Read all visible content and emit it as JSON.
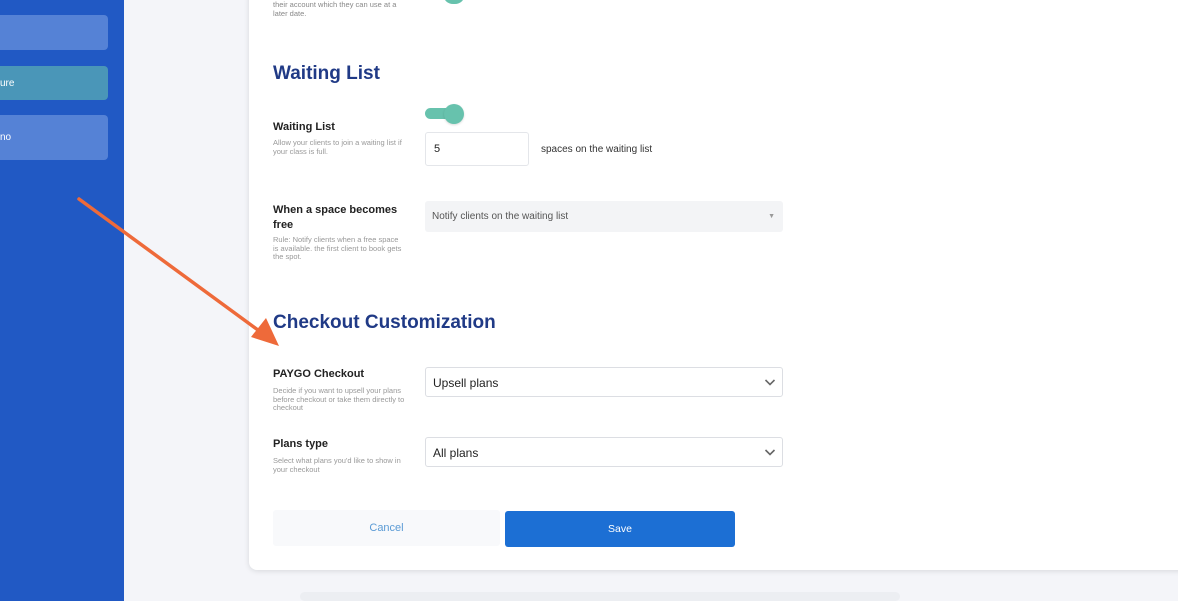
{
  "sidebar": {
    "items": [
      {
        "label": ""
      },
      {
        "label": "ure"
      },
      {
        "label": "no"
      }
    ]
  },
  "top_section": {
    "description_partial": "their account which they can use at a later date."
  },
  "waiting_list": {
    "title": "Waiting List",
    "toggle": {
      "label": "Waiting List",
      "description": "Allow your clients to join a waiting list if your class is full.",
      "enabled": true
    },
    "spaces_value": "5",
    "spaces_suffix": "spaces on the waiting list",
    "space_free": {
      "label": "When a space becomes free",
      "description": "Rule: Notify clients when a free space is available. the first client to book gets the spot.",
      "selected": "Notify clients on the waiting list"
    }
  },
  "checkout": {
    "title": "Checkout Customization",
    "paygo": {
      "label": "PAYGO Checkout",
      "description": "Decide if you want to upsell your plans before checkout or take them directly to checkout",
      "selected": "Upsell plans"
    },
    "plans_type": {
      "label": "Plans type",
      "description": "Select what plans you'd like to show in your checkout",
      "selected": "All plans"
    }
  },
  "actions": {
    "cancel_label": "Cancel",
    "save_label": "Save"
  },
  "colors": {
    "sidebar": "#2159c4",
    "accent_toggle": "#67c2ad",
    "title": "#203a86",
    "primary_button": "#1c6fd4",
    "annotation_arrow": "#ee6a3a"
  }
}
